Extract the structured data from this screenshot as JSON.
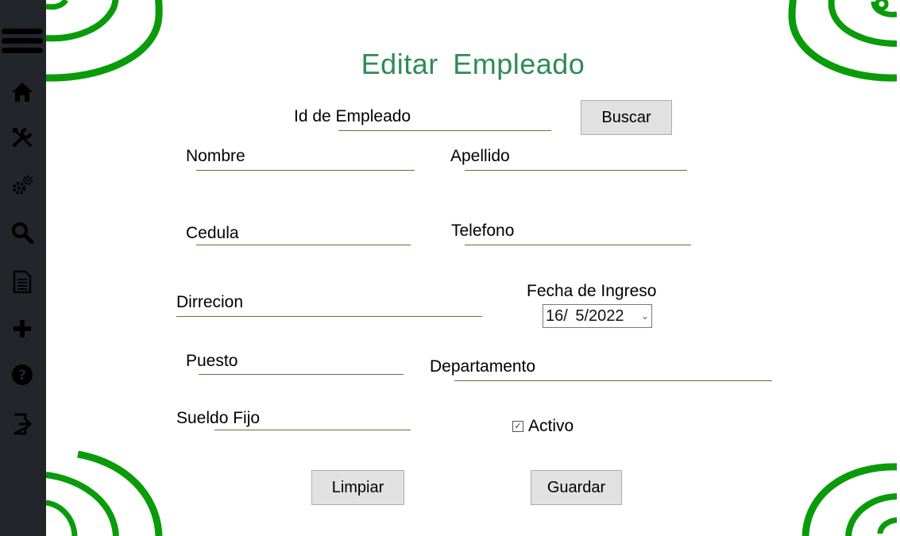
{
  "page": {
    "title": "Editar  Empleado"
  },
  "sidebar": {
    "items": [
      {
        "icon": "menu-icon"
      },
      {
        "icon": "home-icon"
      },
      {
        "icon": "tools-icon"
      },
      {
        "icon": "gears-icon"
      },
      {
        "icon": "search-icon"
      },
      {
        "icon": "document-icon"
      },
      {
        "icon": "plus-icon"
      },
      {
        "icon": "help-icon"
      },
      {
        "icon": "logout-icon"
      }
    ]
  },
  "form": {
    "id_label": "Id de Empleado",
    "search_button": "Buscar",
    "nombre_label": "Nombre",
    "apellido_label": "Apellido",
    "cedula_label": "Cedula",
    "telefono_label": "Telefono",
    "direccion_label": "Dirrecion",
    "fecha_label": "Fecha de Ingreso",
    "fecha_value": "16/  5/2022",
    "puesto_label": "Puesto",
    "departamento_label": "Departamento",
    "sueldo_label": "Sueldo Fijo",
    "activo_label": "Activo",
    "activo_checked": true,
    "clear_button": "Limpiar",
    "save_button": "Guardar"
  },
  "colors": {
    "title": "#2e8b57",
    "sidebar": "#22262b",
    "swirl": "#0a9b0a"
  }
}
